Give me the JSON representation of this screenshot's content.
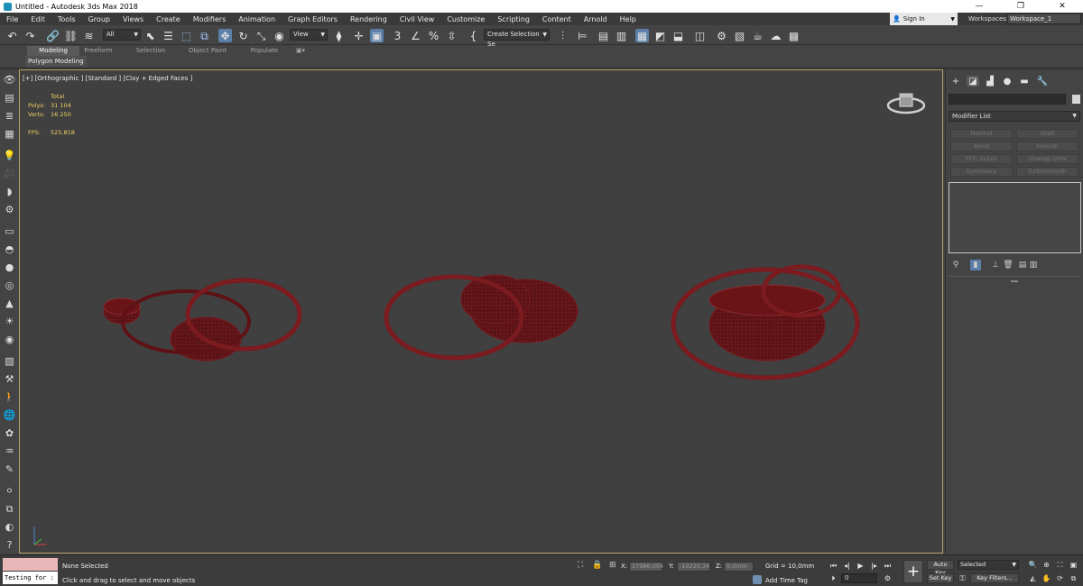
{
  "window": {
    "title": "Untitled - Autodesk 3ds Max 2018",
    "minimize": "—",
    "maximize": "❐",
    "close": "✕"
  },
  "menu": [
    "File",
    "Edit",
    "Tools",
    "Group",
    "Views",
    "Create",
    "Modifiers",
    "Animation",
    "Graph Editors",
    "Rendering",
    "Civil View",
    "Customize",
    "Scripting",
    "Content",
    "Arnold",
    "Help"
  ],
  "account": {
    "signin": "Sign In",
    "workspaces_label": "Workspaces:",
    "workspace": "Workspace_1"
  },
  "toolbar": {
    "filter": "All",
    "ref_coord": "View",
    "snap_3d": "3",
    "percent": "%",
    "selection_set": "Create Selection Se"
  },
  "ribbon": {
    "tabs": [
      "Modeling",
      "Freeform",
      "Selection",
      "Object Paint",
      "Populate"
    ],
    "panel": "Polygon Modeling"
  },
  "viewport": {
    "label": "[+] [Orthographic ] [Standard ] [Clay + Edged Faces ]",
    "stats": {
      "total_label": "Total",
      "polys_label": "Polys:",
      "polys_value": "31 104",
      "verts_label": "Verts:",
      "verts_value": "16 250",
      "fps_label": "FPS:",
      "fps_value": "525,818"
    },
    "wire_color": "#6a1418",
    "fill_color": "#5a1215"
  },
  "command_panel": {
    "modifier_list": "Modifier List",
    "modifier_buttons": [
      "Normal",
      "Shell",
      "Bend",
      "Smooth",
      "FFD 2x2x2",
      "Unwrap UVW",
      "Symmetry",
      "TurboSmooth"
    ]
  },
  "status": {
    "maxscript_text": "Testing for :",
    "selection": "None Selected",
    "prompt": "Click and drag to select and move objects",
    "x_label": "X:",
    "x_value": "17986,004",
    "y_label": "Y:",
    "y_value": "-10220,34",
    "z_label": "Z:",
    "z_value": "0,0mm",
    "grid": "Grid = 10,0mm",
    "add_time_tag": "Add Time Tag",
    "frame": "0",
    "auto_key": "Auto Key",
    "set_key": "Set Key",
    "selected": "Selected",
    "key_filters": "Key Filters..."
  }
}
